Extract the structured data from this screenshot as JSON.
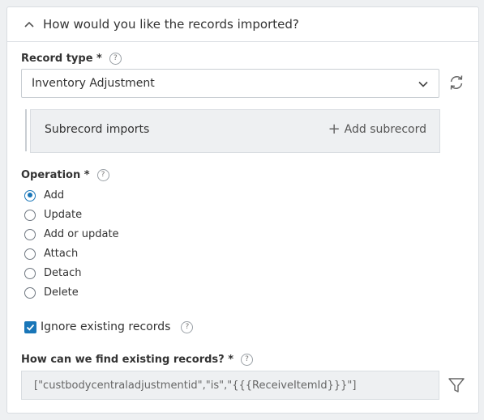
{
  "section": {
    "title": "How would you like the records imported?"
  },
  "record_type": {
    "label": "Record type *",
    "help": "?",
    "value": "Inventory Adjustment"
  },
  "subrecord": {
    "title": "Subrecord imports",
    "add_label": "Add subrecord"
  },
  "operation": {
    "label": "Operation *",
    "help": "?",
    "options": [
      {
        "label": "Add",
        "selected": true
      },
      {
        "label": "Update",
        "selected": false
      },
      {
        "label": "Add or update",
        "selected": false
      },
      {
        "label": "Attach",
        "selected": false
      },
      {
        "label": "Detach",
        "selected": false
      },
      {
        "label": "Delete",
        "selected": false
      }
    ]
  },
  "ignore_existing": {
    "label": "Ignore existing records",
    "checked": true,
    "help": "?"
  },
  "find_existing": {
    "label": "How can we find existing records? *",
    "help": "?",
    "value": "[\"custbodycentraladjustmentid\",\"is\",\"{{{ReceiveItemId}}}\"]"
  },
  "colors": {
    "accent": "#1976b8",
    "border": "#d9dde1",
    "muted_bg": "#eef0f2"
  }
}
